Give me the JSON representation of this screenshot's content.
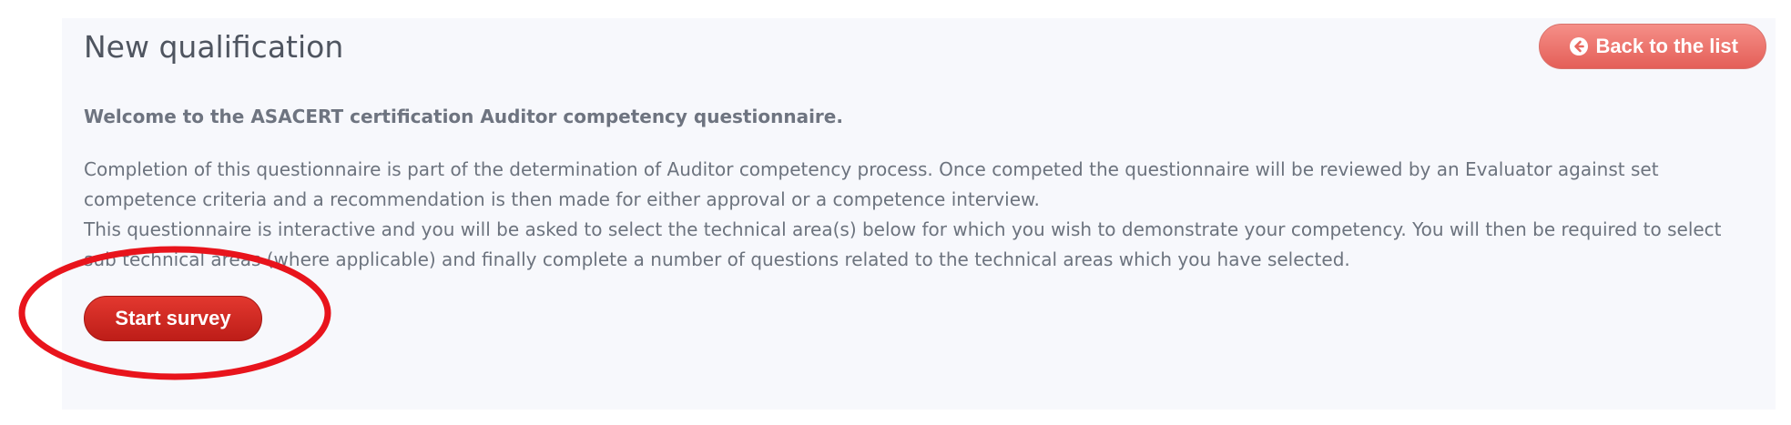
{
  "page": {
    "title": "New qualification",
    "back_button_label": "Back to the list"
  },
  "content": {
    "welcome": "Welcome to the ASACERT certification Auditor competency questionnaire.",
    "paragraph_1": "Completion of this questionnaire is part of the determination of Auditor competency process. Once competed the questionnaire will be reviewed by an Evaluator against set competence criteria and a recommendation is then made for either approval or a competence interview.",
    "paragraph_2": "This questionnaire is interactive and you will be asked to select the technical area(s) below for which you wish to demonstrate your competency. You will then be required to select sub technical areas (where applicable) and finally complete a number of questions related to the technical areas which you have selected."
  },
  "actions": {
    "start_button_label": "Start survey"
  },
  "icons": {
    "back": "circle-arrow-left-icon"
  },
  "colors": {
    "back_button": "#e8675f",
    "start_button": "#d42a23",
    "annotation": "#e8141c"
  }
}
